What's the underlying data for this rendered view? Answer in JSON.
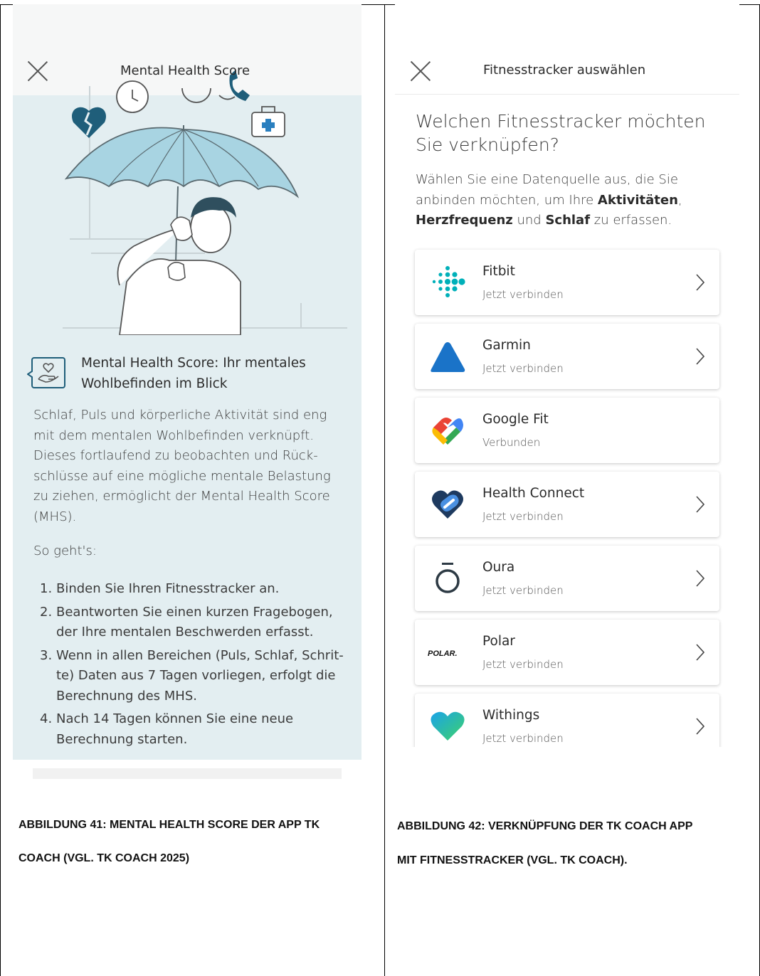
{
  "left_screen": {
    "title": "Mental Health Score",
    "heading": "Mental Health Score: Ihr mentales Wohlbefinden im Blick",
    "paragraph": "Schlaf, Puls und körperliche Aktivität sind eng mit dem mentalen Wohlbefinden verknüpft. Dieses fortlaufend zu beobachten und Rück-schlüsse auf eine mögliche mentale Belastung zu ziehen, ermöglicht der Mental Health Score (MHS).",
    "so_gehts": "So geht's:",
    "steps": [
      {
        "num": "1.",
        "text": "Binden Sie Ihren Fitnesstracker an."
      },
      {
        "num": "2.",
        "text": "Beantworten Sie einen kurzen Fragebogen, der Ihre mentalen Beschwerden erfasst."
      },
      {
        "num": "3.",
        "text": "Wenn in allen Bereichen (Puls, Schlaf, Schrit-te) Daten aus 7 Tagen vorliegen, erfolgt die Berechnung des MHS."
      },
      {
        "num": "4.",
        "text": "Nach 14 Tagen können Sie eine neue Berechnung starten."
      }
    ]
  },
  "right_screen": {
    "title": "Fitnesstracker auswählen",
    "question": "Welchen Fitnesstracker möchten Sie verknüpfen?",
    "desc_a": "Wählen Sie eine Datenquelle aus, die Sie anbinden möchten, um Ihre ",
    "desc_b": "Aktivitäten",
    "desc_c": ",",
    "desc_d": "Herzfrequenz",
    "desc_e": " und ",
    "desc_f": "Schlaf",
    "desc_g": " zu erfassen.",
    "trackers": [
      {
        "name": "Fitbit",
        "status": "Jetzt verbinden",
        "icon": "fitbit-icon"
      },
      {
        "name": "Garmin",
        "status": "Jetzt verbinden",
        "icon": "garmin-icon"
      },
      {
        "name": "Google Fit",
        "status": "Verbunden",
        "icon": "google-fit-icon"
      },
      {
        "name": "Health Connect",
        "status": "Jetzt verbinden",
        "icon": "health-connect-icon"
      },
      {
        "name": "Oura",
        "status": "Jetzt verbinden",
        "icon": "oura-icon"
      },
      {
        "name": "Polar",
        "status": "Jetzt verbinden",
        "icon": "polar-icon",
        "logo_text": "POLAR."
      },
      {
        "name": "Withings",
        "status": "Jetzt verbinden",
        "icon": "withings-icon"
      }
    ]
  },
  "captions": {
    "left_line1": "ABBILDUNG 41: MENTAL HEALTH SCORE DER APP TK",
    "left_line2": "COACH (VGL. TK COACH 2025)",
    "right_line1": "ABBILDUNG 42: VERKNÜPFUNG DER TK COACH APP",
    "right_line2": "MIT FITNESSTRACKER (VGL. TK COACH)."
  },
  "colors": {
    "left_bg": "#e3eef1",
    "fitbit": "#00b0b9",
    "garmin": "#1a73c8",
    "health_connect": "#1565c0",
    "oura": "#2d3a44",
    "withings": "#2ec27e"
  }
}
